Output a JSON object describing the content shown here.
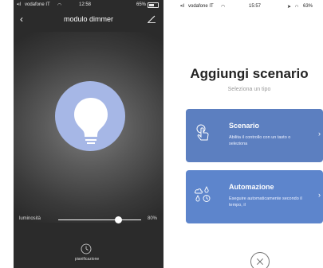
{
  "left_screen": {
    "status": {
      "carrier": "vodafone IT",
      "time": "12:58",
      "battery": "65%"
    },
    "nav": {
      "title": "modulo dimmer"
    },
    "brightness": {
      "label": "luminosità",
      "value_label": "80%",
      "level": 0.8
    },
    "schedule": {
      "label": "pianificazione"
    },
    "colors": {
      "background": "#2b2b2b",
      "bulb_circle": "#a6b7e6"
    }
  },
  "right_screen": {
    "status": {
      "carrier": "vodafone IT",
      "time": "15:57",
      "battery": "63%"
    },
    "title": "Aggiungi scenario",
    "subtitle": "Seleziona un tipo",
    "cards": [
      {
        "title": "Scenario",
        "description": "Abilita il controllo con un tasto o seleziona",
        "icon": "tap-hand-icon"
      },
      {
        "title": "Automazione",
        "description": "Eseguire automaticamente secondo il tempo, il",
        "icon": "weather-automation-icon"
      }
    ],
    "colors": {
      "card": "#5c7fc0"
    }
  }
}
